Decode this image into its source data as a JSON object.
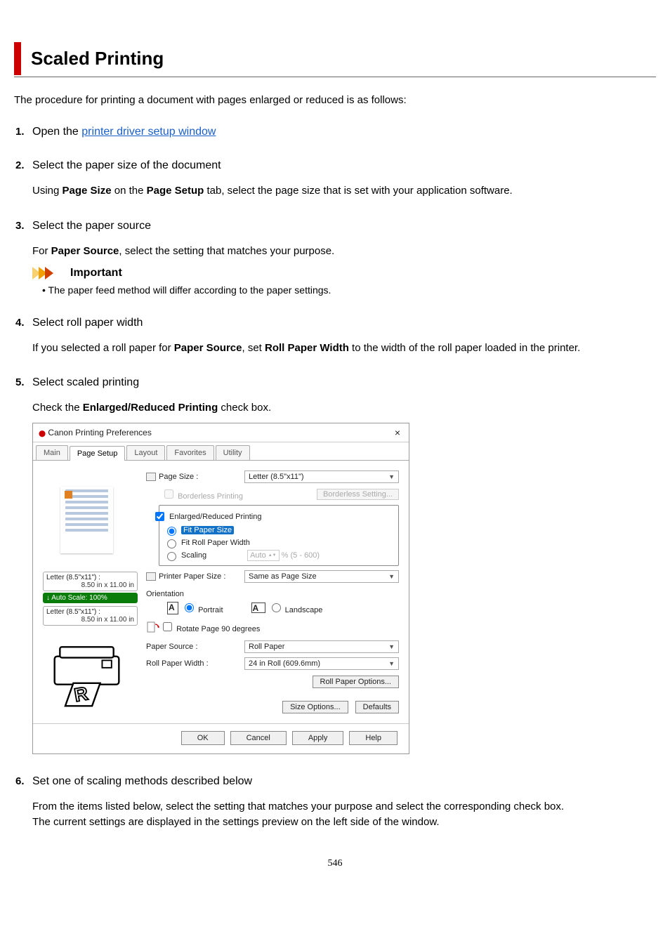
{
  "title": "Scaled Printing",
  "intro": "The procedure for printing a document with pages enlarged or reduced is as follows:",
  "steps": {
    "s1": {
      "prefix": "Open the ",
      "link": "printer driver setup window"
    },
    "s2": {
      "head": "Select the paper size of the document",
      "body_pre": "Using ",
      "body_b1": "Page Size",
      "body_mid1": " on the ",
      "body_b2": "Page Setup",
      "body_post": " tab, select the page size that is set with your application software."
    },
    "s3": {
      "head": "Select the paper source",
      "body_pre": "For ",
      "body_b1": "Paper Source",
      "body_post": ", select the setting that matches your purpose.",
      "important_label": "Important",
      "important_item": "The paper feed method will differ according to the paper settings."
    },
    "s4": {
      "head": "Select roll paper width",
      "body_pre": "If you selected a roll paper for ",
      "body_b1": "Paper Source",
      "body_mid1": ", set ",
      "body_b2": "Roll Paper Width",
      "body_post": " to the width of the roll paper loaded in the printer."
    },
    "s5": {
      "head": "Select scaled printing",
      "body_pre": "Check the ",
      "body_b1": "Enlarged/Reduced Printing",
      "body_post": " check box."
    },
    "s6": {
      "head": "Set one of scaling methods described below",
      "body1": "From the items listed below, select the setting that matches your purpose and select the corresponding check box.",
      "body2": "The current settings are displayed in the settings preview on the left side of the window."
    }
  },
  "dialog": {
    "title": "Canon            Printing Preferences",
    "close": "×",
    "tabs": {
      "main": "Main",
      "page_setup": "Page Setup",
      "layout": "Layout",
      "favorites": "Favorites",
      "utility": "Utility"
    },
    "preview": {
      "cap1_title": "Letter (8.5\"x11\") :",
      "cap1_dims": "8.50 in x 11.00 in",
      "scale_label": "Auto Scale: 100%",
      "cap2_title": "Letter (8.5\"x11\") :",
      "cap2_dims": "8.50 in x 11.00 in"
    },
    "fields": {
      "page_size_label": "Page Size :",
      "page_size_value": "Letter (8.5\"x11\")",
      "borderless_printing": "Borderless Printing",
      "borderless_setting": "Borderless Setting...",
      "enlarged_reduced": "Enlarged/Reduced Printing",
      "fit_paper_size": "Fit Paper Size",
      "fit_roll_width": "Fit Roll Paper Width",
      "scaling": "Scaling",
      "scaling_auto": "Auto",
      "scaling_range": "% (5 - 600)",
      "printer_paper_size_label": "Printer Paper Size :",
      "printer_paper_size_value": "Same as Page Size",
      "orientation_label": "Orientation",
      "portrait": "Portrait",
      "landscape": "Landscape",
      "rotate_90": "Rotate Page 90 degrees",
      "paper_source_label": "Paper Source :",
      "paper_source_value": "Roll Paper",
      "roll_paper_width_label": "Roll Paper Width :",
      "roll_paper_width_value": "24 in Roll (609.6mm)",
      "roll_paper_options": "Roll Paper Options...",
      "size_options": "Size Options...",
      "defaults": "Defaults"
    },
    "footer": {
      "ok": "OK",
      "cancel": "Cancel",
      "apply": "Apply",
      "help": "Help"
    }
  },
  "page_number": "546"
}
